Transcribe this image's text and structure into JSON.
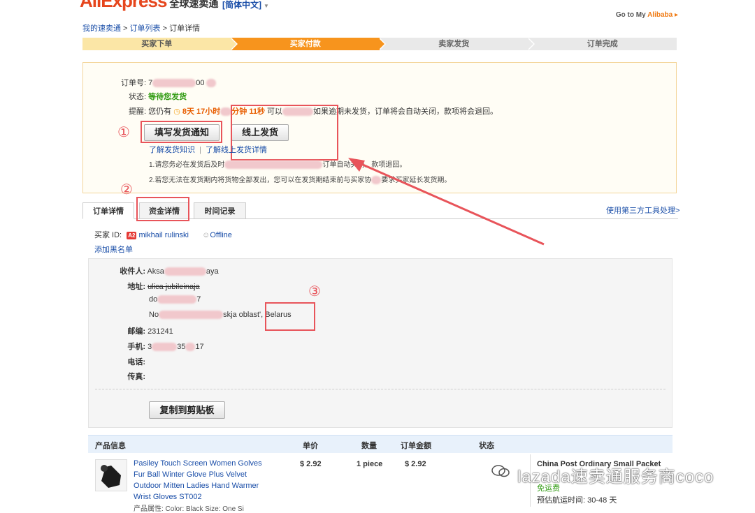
{
  "header": {
    "logo_text": "AliExpress",
    "logo_sub": "全球速卖通",
    "language": "[简体中文]",
    "goto_prefix": "Go to My ",
    "goto_brand": "Alibaba"
  },
  "breadcrumb": {
    "items": [
      "我的速卖通",
      "订单列表",
      "订单详情"
    ],
    "sep": " > "
  },
  "steps": [
    "买家下单",
    "买家付款",
    "卖家发货",
    "订单完成"
  ],
  "order": {
    "number_label": "订单号:",
    "number_prefix": "7",
    "number_suffix": "00",
    "status_label": "状态:",
    "status_value": "等待您发货",
    "reminder_label": "提醒:",
    "reminder_prefix": "您仍有",
    "reminder_timer_a": "8天 17小时",
    "reminder_timer_b": "分钟 11秒",
    "reminder_mid": "可以",
    "reminder_rest": "如果逾期未发货，订单将会自动关闭，款项将会退回。",
    "fill_notice_button": "填写发货通知",
    "online_ship_button": "线上发货",
    "link_knowledge": "了解发货知识",
    "link_sep": "|",
    "link_online": "了解线上发货详情",
    "note1": "1.请您务必在发货后及时",
    "note1_end": "订单自动关闭，款项退回。",
    "note2": "2.若您无法在发货期内将货物全部发出，您可以在发货期结束前与买家协",
    "note2_end": "要求买家延长发货期。"
  },
  "annotations": [
    "①",
    "②",
    "③"
  ],
  "tabs": [
    "订单详情",
    "资金详情",
    "时间记录"
  ],
  "third_party_link": "使用第三方工具处理>",
  "buyer": {
    "id_label": "买家 ID:",
    "badge": "A2",
    "name": "mikhail rulinski",
    "status": "Offline",
    "blacklist": "添加黑名单"
  },
  "address": {
    "recipient_label": "收件人:",
    "recipient_prefix": "Aksa",
    "recipient_suffix": "aya",
    "addr_label": "地址:",
    "line1": "ulica jubileinaja",
    "line2_prefix": "do",
    "line2_suffix": "7",
    "line3_prefix": "No",
    "line3_mid": "skja oblast',",
    "line3_country": "Belarus",
    "zip_label": "邮编:",
    "zip": "231241",
    "phone_label": "手机:",
    "phone_prefix": "3",
    "phone_mid": "35",
    "phone_suffix": "17",
    "tel_label": "电话:",
    "fax_label": "传真:",
    "copy_button": "复制到剪贴板"
  },
  "table": {
    "headers": [
      "产品信息",
      "单价",
      "数量",
      "订单金额",
      "状态"
    ],
    "product_title_lines": [
      "Pasiley Touch Screen Women Golves",
      "Fur Ball Winter Glove Plus Velvet",
      "Outdoor Mitten Ladies Hand Warmer",
      "Wrist Gloves ST002"
    ],
    "product_attr": "产品属性: Color: Black Size: One Si",
    "price": "$ 2.92",
    "qty": "1 piece",
    "amount": "$ 2.92",
    "shipping_method": "China Post Ordinary Small Packet",
    "free_shipping": "免运费",
    "eta_label": "预估航运时间:",
    "eta_value": "30-48 天"
  },
  "watermark": "lazada速卖通服务商coco",
  "colors": {
    "accent_orange": "#f7941d",
    "link_blue": "#1a4ea8",
    "status_green": "#2e9a0f",
    "annotation_red": "#e8545a"
  }
}
